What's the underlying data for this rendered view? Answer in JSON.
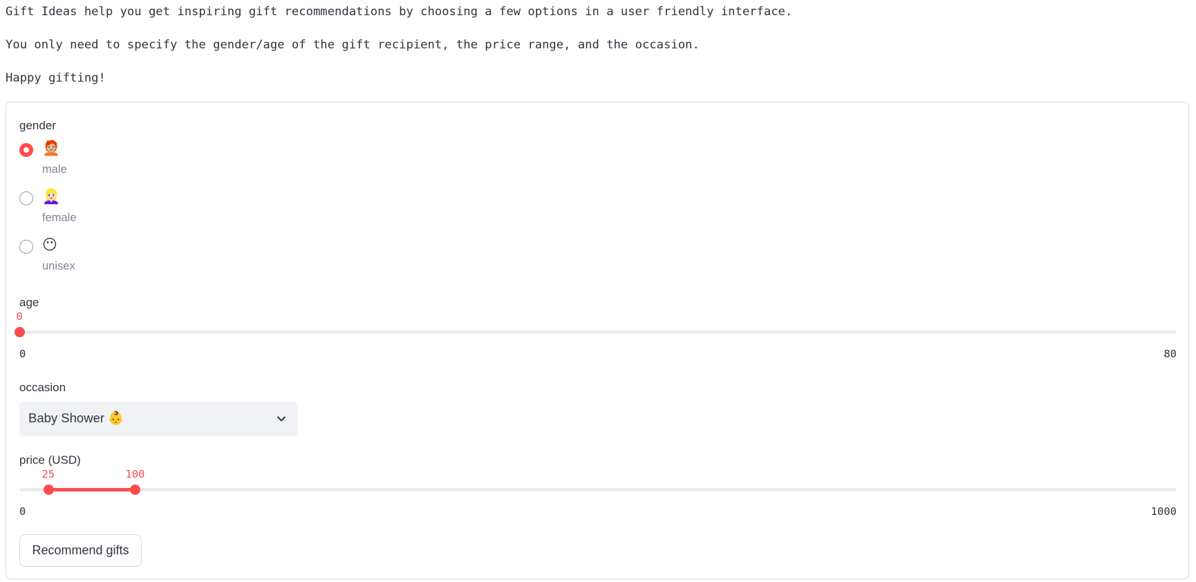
{
  "intro": {
    "line1": "Gift Ideas help you get inspiring gift recommendations by choosing a few options in a user friendly interface.",
    "line2": "You only need to specify the gender/age of the gift recipient, the price range, and the occasion.",
    "line3": "Happy gifting!"
  },
  "form": {
    "gender": {
      "label": "gender",
      "selected": "male",
      "options": [
        {
          "emoji": "🧑🏼‍🦰",
          "caption": "male",
          "icon": "man-emoji-icon"
        },
        {
          "emoji": "👱🏻‍♀️",
          "caption": "female",
          "icon": "woman-emoji-icon"
        },
        {
          "emoji": "😶",
          "caption": "unisex",
          "icon": "neutral-face-emoji-icon"
        }
      ]
    },
    "age": {
      "label": "age",
      "value": 0,
      "value_text": "0",
      "min": 0,
      "max": 80,
      "min_text": "0",
      "max_text": "80"
    },
    "occasion": {
      "label": "occasion",
      "selected": "Baby Shower 👶"
    },
    "price": {
      "label": "price (USD)",
      "low": 25,
      "high": 100,
      "low_text": "25",
      "high_text": "100",
      "min": 0,
      "max": 1000,
      "min_text": "0",
      "max_text": "1000"
    },
    "button_label": "Recommend gifts"
  },
  "colors": {
    "accent": "#ff4b4b",
    "text": "#31333f",
    "muted": "#808495",
    "track": "#ececee",
    "select_bg": "#f0f2f6",
    "border": "#d6d6d9"
  }
}
